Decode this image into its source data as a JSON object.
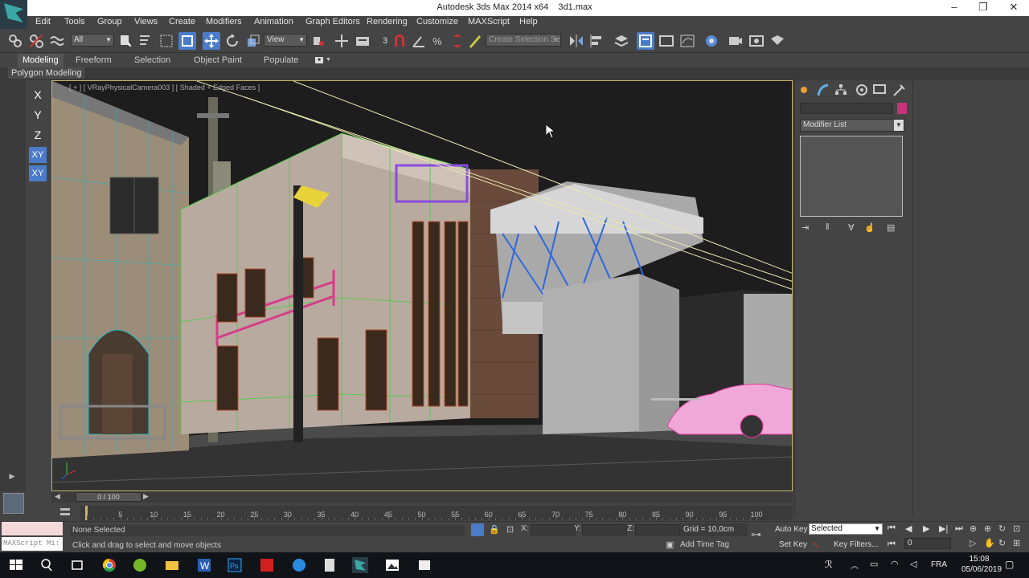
{
  "window": {
    "app_title": "Autodesk 3ds Max  2014 x64",
    "file_name": "3d1.max"
  },
  "menu": [
    "Edit",
    "Tools",
    "Group",
    "Views",
    "Create",
    "Modifiers",
    "Animation",
    "Graph Editors",
    "Rendering",
    "Customize",
    "MAXScript",
    "Help"
  ],
  "toolbar": {
    "selection_filter": "All",
    "ref_coord": "View",
    "named_selection_placeholder": "Create Selection Se",
    "snap_value": "3"
  },
  "ribbon": {
    "tabs": [
      "Modeling",
      "Freeform",
      "Selection",
      "Object Paint",
      "Populate"
    ],
    "active_tab": "Modeling",
    "panel": "Polygon Modeling"
  },
  "axis_constraints": [
    "X",
    "Y",
    "Z",
    "XY",
    "XY"
  ],
  "viewport": {
    "label": "[ + ] [ VRayPhysicalCamera003 ] [ Shaded + Edged Faces ]"
  },
  "command_panel": {
    "modifier_list": "Modifier List"
  },
  "timeline": {
    "slider": "0 / 100",
    "ticks": [
      "5",
      "10",
      "15",
      "20",
      "25",
      "30",
      "35",
      "40",
      "45",
      "50",
      "55",
      "60",
      "65",
      "70",
      "75",
      "80",
      "85",
      "90",
      "95",
      "100"
    ]
  },
  "status": {
    "maxscript_placeholder": "MAXScript Mi:",
    "selection": "None Selected",
    "prompt": "Click and drag to select and move objects",
    "x_label": "X:",
    "y_label": "Y:",
    "z_label": "Z:",
    "grid": "Grid = 10,0cm",
    "add_time_tag": "Add Time Tag",
    "auto_key": "Auto Key",
    "set_key": "Set Key",
    "selected_dd": "Selected",
    "key_filters": "Key Filters...",
    "frame": "0"
  },
  "taskbar": {
    "language": "FRA",
    "time": "15:08",
    "date": "05/06/2019"
  }
}
